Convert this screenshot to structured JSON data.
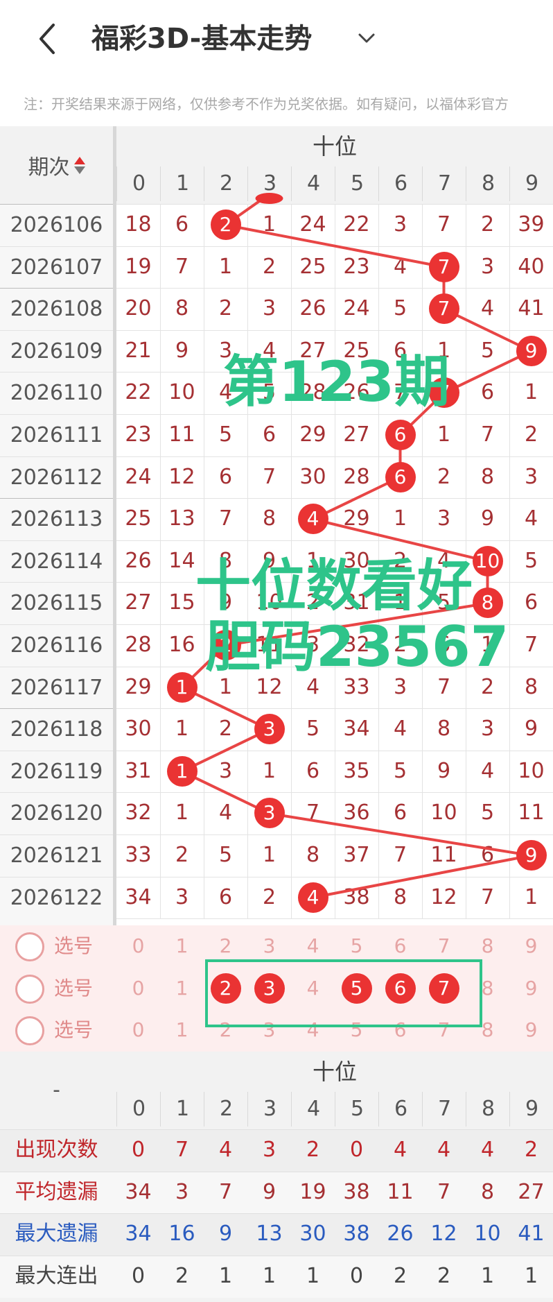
{
  "header": {
    "title": "福彩3D-基本走势",
    "back_icon": "chevron-left-icon",
    "dropdown_icon": "chevron-down-icon"
  },
  "notice": "注：开奖结果来源于网络，仅供参考不作为兑奖依据。如有疑问，以福体彩官方",
  "table": {
    "period_header": "期次",
    "group_title": "十位",
    "digits": [
      "0",
      "1",
      "2",
      "3",
      "4",
      "5",
      "6",
      "7",
      "8",
      "9"
    ],
    "rows": [
      {
        "period": "2026106",
        "cells": [
          "18",
          "6",
          "2",
          "1",
          "24",
          "22",
          "3",
          "7",
          "2",
          "39"
        ],
        "hit": 2
      },
      {
        "period": "2026107",
        "cells": [
          "19",
          "7",
          "1",
          "2",
          "25",
          "23",
          "4",
          "7",
          "3",
          "40"
        ],
        "hit": 7
      },
      {
        "period": "2026108",
        "cells": [
          "20",
          "8",
          "2",
          "3",
          "26",
          "24",
          "5",
          "7",
          "4",
          "41"
        ],
        "hit": 7
      },
      {
        "period": "2026109",
        "cells": [
          "21",
          "9",
          "3",
          "4",
          "27",
          "25",
          "6",
          "1",
          "5",
          "9"
        ],
        "hit": 9
      },
      {
        "period": "2026110",
        "cells": [
          "22",
          "10",
          "4",
          "5",
          "28",
          "26",
          "7",
          "7",
          "6",
          "1"
        ],
        "hit": 7
      },
      {
        "period": "2026111",
        "cells": [
          "23",
          "11",
          "5",
          "6",
          "29",
          "27",
          "6",
          "1",
          "7",
          "2"
        ],
        "hit": 6
      },
      {
        "period": "2026112",
        "cells": [
          "24",
          "12",
          "6",
          "7",
          "30",
          "28",
          "6",
          "2",
          "8",
          "3"
        ],
        "hit": 6
      },
      {
        "period": "2026113",
        "cells": [
          "25",
          "13",
          "7",
          "8",
          "4",
          "29",
          "1",
          "3",
          "9",
          "4"
        ],
        "hit": 4
      },
      {
        "period": "2026114",
        "cells": [
          "26",
          "14",
          "8",
          "9",
          "1",
          "30",
          "2",
          "4",
          "10",
          "5"
        ],
        "hit": 8
      },
      {
        "period": "2026115",
        "cells": [
          "27",
          "15",
          "9",
          "10",
          "2",
          "31",
          "1",
          "5",
          "8",
          "6"
        ],
        "hit": 8
      },
      {
        "period": "2026116",
        "cells": [
          "28",
          "16",
          "2",
          "11",
          "3",
          "32",
          "2",
          "6",
          "1",
          "7"
        ],
        "hit": 2
      },
      {
        "period": "2026117",
        "cells": [
          "29",
          "1",
          "1",
          "12",
          "4",
          "33",
          "3",
          "7",
          "2",
          "8"
        ],
        "hit": 1
      },
      {
        "period": "2026118",
        "cells": [
          "30",
          "1",
          "2",
          "3",
          "5",
          "34",
          "4",
          "8",
          "3",
          "9"
        ],
        "hit": 3
      },
      {
        "period": "2026119",
        "cells": [
          "31",
          "1",
          "3",
          "1",
          "6",
          "35",
          "5",
          "9",
          "4",
          "10"
        ],
        "hit": 1
      },
      {
        "period": "2026120",
        "cells": [
          "32",
          "1",
          "4",
          "3",
          "7",
          "36",
          "6",
          "10",
          "5",
          "11"
        ],
        "hit": 3
      },
      {
        "period": "2026121",
        "cells": [
          "33",
          "2",
          "5",
          "1",
          "8",
          "37",
          "7",
          "11",
          "6",
          "9"
        ],
        "hit": 9
      },
      {
        "period": "2026122",
        "cells": [
          "34",
          "3",
          "6",
          "2",
          "4",
          "38",
          "8",
          "12",
          "7",
          "1"
        ],
        "hit": 4
      }
    ]
  },
  "selection": {
    "label": "选号",
    "rows": [
      {
        "selected": []
      },
      {
        "selected": [
          2,
          3,
          5,
          6,
          7
        ]
      },
      {
        "selected": []
      }
    ]
  },
  "stats": {
    "dash": "-",
    "group_title": "十位",
    "rows": [
      {
        "label": "出现次数",
        "color": "#c0262b",
        "values": [
          "0",
          "7",
          "4",
          "3",
          "2",
          "0",
          "4",
          "4",
          "4",
          "2"
        ],
        "value_color": "#c0262b"
      },
      {
        "label": "平均遗漏",
        "color": "#c0262b",
        "values": [
          "34",
          "3",
          "7",
          "9",
          "19",
          "38",
          "11",
          "7",
          "8",
          "27"
        ],
        "value_color": "#a53033"
      },
      {
        "label": "最大遗漏",
        "color": "#2a5bbf",
        "values": [
          "34",
          "16",
          "9",
          "13",
          "30",
          "38",
          "26",
          "12",
          "10",
          "41"
        ],
        "value_color": "#2a5bbf"
      },
      {
        "label": "最大连出",
        "color": "#444444",
        "values": [
          "0",
          "2",
          "1",
          "1",
          "1",
          "0",
          "2",
          "2",
          "1",
          "1"
        ],
        "value_color": "#444444"
      }
    ]
  },
  "overlays": {
    "issue": "第123期",
    "line1": "十位数看好",
    "line2": "胆码23567"
  },
  "colors": {
    "ball": "#ea3333",
    "line": "#e84545",
    "highlight_box": "#2ec48a"
  }
}
